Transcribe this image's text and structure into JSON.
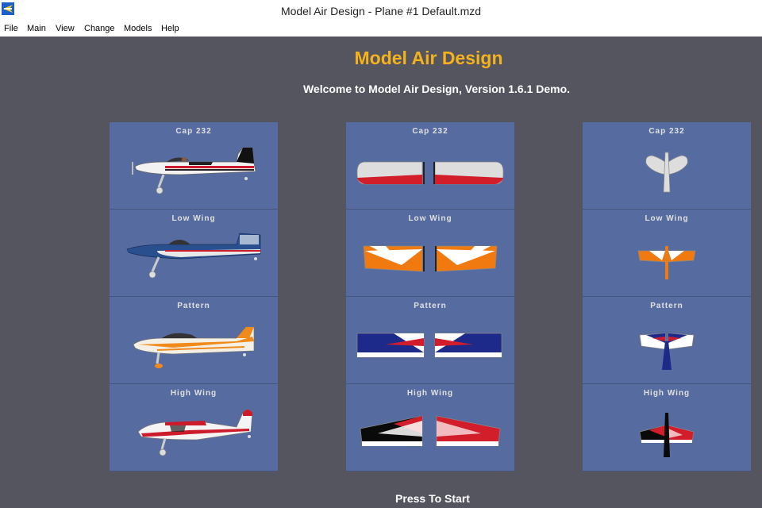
{
  "window": {
    "title": "Model Air Design - Plane #1  Default.mzd",
    "icon": "plane-app-icon"
  },
  "menu": [
    "File",
    "Main",
    "View",
    "Change",
    "Models",
    "Help"
  ],
  "heading": "Model Air Design",
  "welcome": "Welcome to Model Air Design, Version 1.6.1 Demo.",
  "columns": [
    {
      "view": "side",
      "panels": [
        {
          "label": "Cap 232"
        },
        {
          "label": "Low Wing"
        },
        {
          "label": "Pattern"
        },
        {
          "label": "High Wing"
        }
      ]
    },
    {
      "view": "wing",
      "panels": [
        {
          "label": "Cap 232"
        },
        {
          "label": "Low Wing"
        },
        {
          "label": "Pattern"
        },
        {
          "label": "High Wing"
        }
      ]
    },
    {
      "view": "tail",
      "panels": [
        {
          "label": "Cap 232"
        },
        {
          "label": "Low Wing"
        },
        {
          "label": "Pattern"
        },
        {
          "label": "High Wing"
        }
      ]
    }
  ],
  "start_label": "Press To Start",
  "colors": {
    "heading": "#f5b21b",
    "panel": "#566b9f",
    "background": "#55555f"
  }
}
